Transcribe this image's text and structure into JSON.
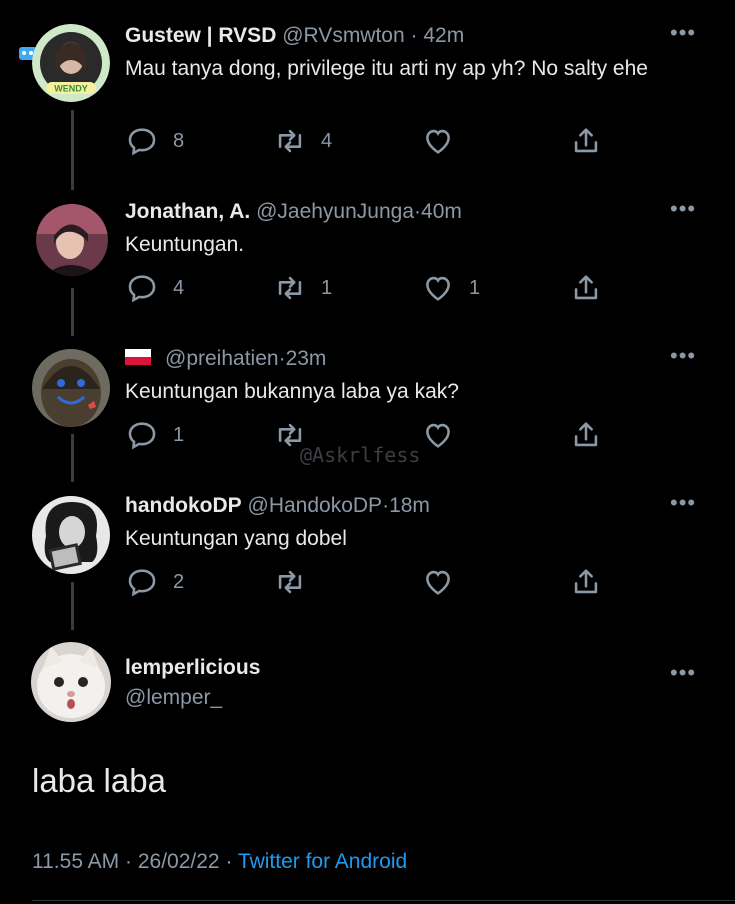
{
  "replies": [
    {
      "name": "Gustew | RVSD",
      "handle": "@RVsmwton",
      "time": "42m",
      "text": "Mau tanya dong, privilege itu arti ny ap yh? No salty ehe",
      "reply_count": "8",
      "retweet_count": "4",
      "like_count": "",
      "avatar_caption": "WENDY"
    },
    {
      "name": "Jonathan, A.",
      "handle": "@JaehyunJunga",
      "time": "40m",
      "text": "Keuntungan.",
      "reply_count": "4",
      "retweet_count": "1",
      "like_count": "1"
    },
    {
      "name": "",
      "handle": "@preihatien",
      "time": "23m",
      "text": "Keuntungan bukannya laba ya kak?",
      "reply_count": "1",
      "retweet_count": "",
      "like_count": ""
    },
    {
      "name": "handokoDP",
      "handle": "@HandokoDP",
      "time": "18m",
      "text": "Keuntungan yang dobel",
      "reply_count": "2",
      "retweet_count": "",
      "like_count": ""
    }
  ],
  "separator": "·",
  "more_label": "•••",
  "watermark": "@Askrlfess",
  "main_tweet": {
    "name": "lemperlicious",
    "handle": "@lemper_",
    "text": "laba laba",
    "time": "11.55 AM",
    "date": "26/02/22",
    "source": "Twitter for Android"
  },
  "colors": {
    "background": "#000000",
    "text": "#e7e9ea",
    "muted": "#8b98a5",
    "link": "#1d9bf0"
  },
  "icons": [
    "reply-icon",
    "retweet-icon",
    "like-icon",
    "share-icon",
    "more-icon",
    "poland-flag-icon"
  ]
}
